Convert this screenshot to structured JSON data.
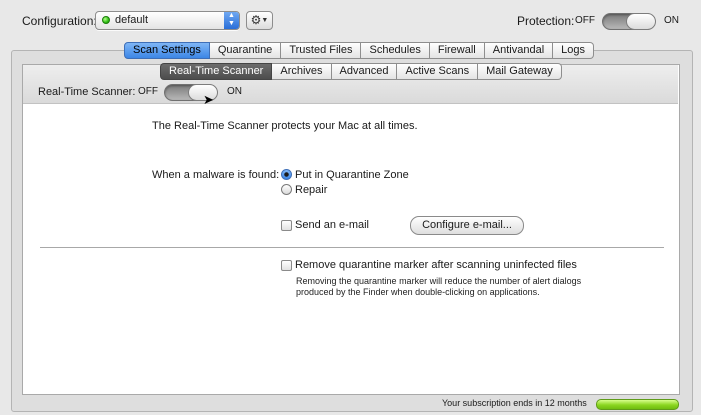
{
  "configuration": {
    "label": "Configuration:",
    "value": "default",
    "status_color": "#2fbf14"
  },
  "protection": {
    "label": "Protection:",
    "off": "OFF",
    "on": "ON",
    "state": "on"
  },
  "main_tabs": [
    {
      "label": "Scan Settings",
      "selected": true
    },
    {
      "label": "Quarantine"
    },
    {
      "label": "Trusted Files"
    },
    {
      "label": "Schedules"
    },
    {
      "label": "Firewall"
    },
    {
      "label": "Antivandal"
    },
    {
      "label": "Logs"
    }
  ],
  "sub_tabs": [
    {
      "label": "Real-Time Scanner",
      "selected": true
    },
    {
      "label": "Archives"
    },
    {
      "label": "Advanced"
    },
    {
      "label": "Active Scans"
    },
    {
      "label": "Mail Gateway"
    }
  ],
  "rts": {
    "label": "Real-Time Scanner:",
    "off": "OFF",
    "on": "ON",
    "state": "on"
  },
  "content": {
    "intro": "The Real-Time Scanner protects your Mac at all times.",
    "malware_label": "When a malware is found:",
    "radio_quarantine": "Put in Quarantine Zone",
    "radio_repair": "Repair",
    "send_email": "Send an e-mail",
    "configure_email": "Configure e-mail...",
    "remove_marker": "Remove quarantine marker after scanning uninfected files",
    "note_line1": "Removing the quarantine marker will reduce the number of alert dialogs",
    "note_line2": "produced by the Finder when double-clicking on applications."
  },
  "footer": {
    "subscription": "Your subscription ends in 12 months",
    "subscription_color": "#8bd621"
  },
  "icons": {
    "gear": "gear-icon",
    "status_dot": "status-dot-icon",
    "cursor": "mouse-cursor-icon"
  }
}
